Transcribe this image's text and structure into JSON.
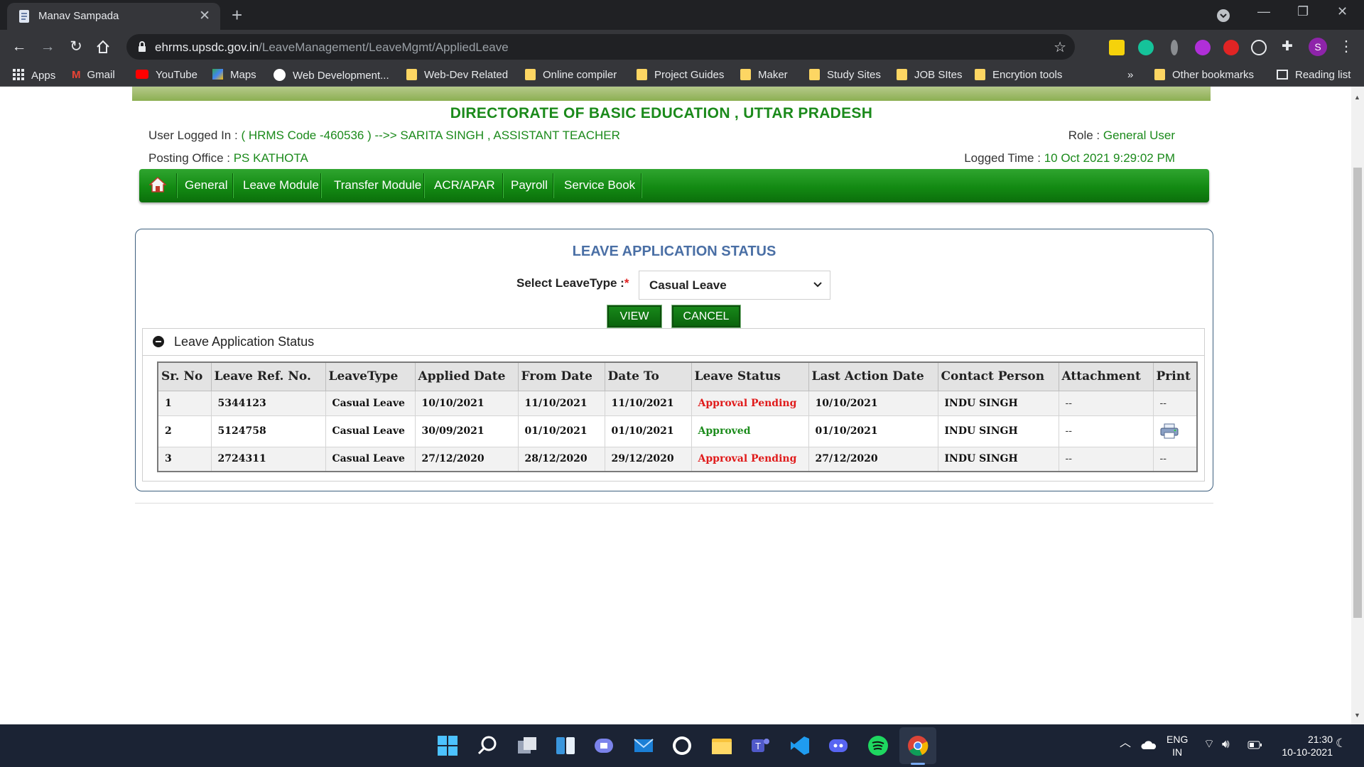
{
  "browser": {
    "tab_title": "Manav Sampada",
    "url_host": "ehrms.upsdc.gov.in",
    "url_path": "/LeaveManagement/LeaveMgmt/AppliedLeave",
    "profile_initial": "S",
    "bookmarks": [
      "Apps",
      "Gmail",
      "YouTube",
      "Maps",
      "Web Development...",
      "Web-Dev Related",
      "Online compiler",
      "Project Guides",
      "Maker",
      "Study Sites",
      "JOB SItes",
      "Encrytion tools"
    ],
    "overflow": "»",
    "other_bookmarks": "Other bookmarks",
    "reading_list": "Reading list"
  },
  "header": {
    "org_title": "DIRECTORATE OF BASIC EDUCATION , UTTAR PRADESH",
    "user_label": "User Logged In :",
    "user_value": "( HRMS Code -460536 ) -->> SARITA SINGH , ASSISTANT TEACHER",
    "role_label": "Role :",
    "role_value": "General User",
    "posting_label": "Posting Office :",
    "posting_value": "PS KATHOTA",
    "logged_label": "Logged Time :",
    "logged_value": "10 Oct 2021 9:29:02 PM"
  },
  "menu": [
    "General",
    "Leave Module",
    "Transfer Module",
    "ACR/APAR",
    "Payroll",
    "Service Book"
  ],
  "form": {
    "title": "LEAVE APPLICATION STATUS",
    "leave_type_label": "Select LeaveType :",
    "required_mark": "*",
    "leave_type_value": "Casual Leave",
    "view_button": "VIEW",
    "cancel_button": "CANCEL"
  },
  "status_section": {
    "title": "Leave Application Status",
    "columns": [
      "Sr. No",
      "Leave Ref. No.",
      "LeaveType",
      "Applied Date",
      "From Date",
      "Date To",
      "Leave Status",
      "Last Action Date",
      "Contact Person",
      "Attachment",
      "Print"
    ],
    "rows": [
      {
        "sr": "1",
        "ref": "5344123",
        "type": "Casual Leave",
        "applied": "10/10/2021",
        "from": "11/10/2021",
        "to": "11/10/2021",
        "status": "Approval Pending",
        "last_action": "10/10/2021",
        "contact": "INDU SINGH",
        "attachment": "--",
        "print": "--"
      },
      {
        "sr": "2",
        "ref": "5124758",
        "type": "Casual Leave",
        "applied": "30/09/2021",
        "from": "01/10/2021",
        "to": "01/10/2021",
        "status": "Approved",
        "last_action": "01/10/2021",
        "contact": "INDU SINGH",
        "attachment": "--",
        "print": "printer-icon"
      },
      {
        "sr": "3",
        "ref": "2724311",
        "type": "Casual Leave",
        "applied": "27/12/2020",
        "from": "28/12/2020",
        "to": "29/12/2020",
        "status": "Approval Pending",
        "last_action": "27/12/2020",
        "contact": "INDU SINGH",
        "attachment": "--",
        "print": "--"
      }
    ]
  },
  "taskbar": {
    "lang_top": "ENG",
    "lang_bottom": "IN",
    "time": "21:30",
    "date": "10-10-2021"
  },
  "colors": {
    "menu_green": "#138a13",
    "header_green": "#1b8a1b",
    "pending_red": "#e01b1b",
    "approved_green": "#1c8c1c",
    "panel_title_blue": "#4a6fa5"
  }
}
